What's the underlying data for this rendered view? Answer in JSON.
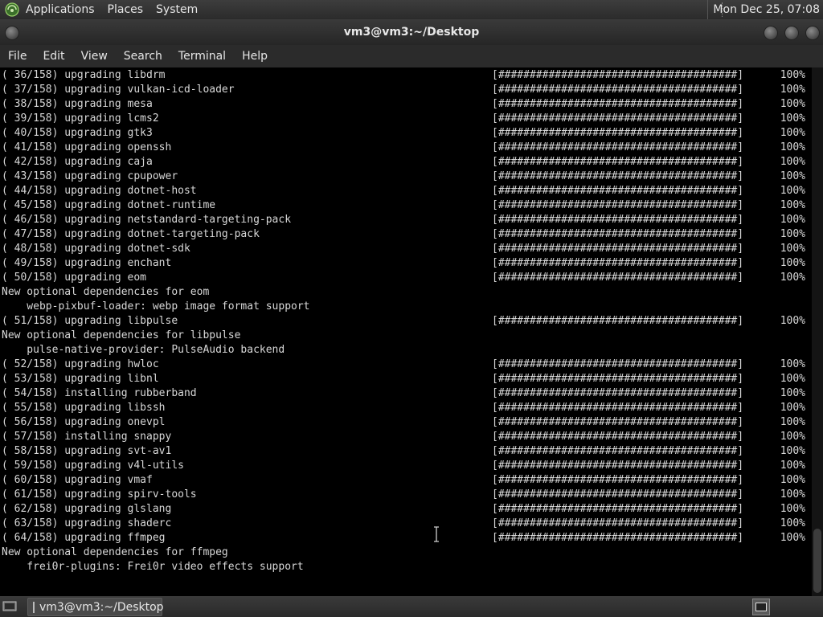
{
  "top_panel": {
    "menus": [
      "Applications",
      "Places",
      "System"
    ],
    "clock": "Mon Dec 25, 07:08"
  },
  "window": {
    "title": "vm3@vm3:~/Desktop"
  },
  "menubar": [
    "File",
    "Edit",
    "View",
    "Search",
    "Terminal",
    "Help"
  ],
  "terminal": {
    "lines": [
      {
        "text": "( 36/158) upgrading libdrm",
        "bar": "[######################################]",
        "pct": "100%"
      },
      {
        "text": "( 37/158) upgrading vulkan-icd-loader",
        "bar": "[######################################]",
        "pct": "100%"
      },
      {
        "text": "( 38/158) upgrading mesa",
        "bar": "[######################################]",
        "pct": "100%"
      },
      {
        "text": "( 39/158) upgrading lcms2",
        "bar": "[######################################]",
        "pct": "100%"
      },
      {
        "text": "( 40/158) upgrading gtk3",
        "bar": "[######################################]",
        "pct": "100%"
      },
      {
        "text": "( 41/158) upgrading openssh",
        "bar": "[######################################]",
        "pct": "100%"
      },
      {
        "text": "( 42/158) upgrading caja",
        "bar": "[######################################]",
        "pct": "100%"
      },
      {
        "text": "( 43/158) upgrading cpupower",
        "bar": "[######################################]",
        "pct": "100%"
      },
      {
        "text": "( 44/158) upgrading dotnet-host",
        "bar": "[######################################]",
        "pct": "100%"
      },
      {
        "text": "( 45/158) upgrading dotnet-runtime",
        "bar": "[######################################]",
        "pct": "100%"
      },
      {
        "text": "( 46/158) upgrading netstandard-targeting-pack",
        "bar": "[######################################]",
        "pct": "100%"
      },
      {
        "text": "( 47/158) upgrading dotnet-targeting-pack",
        "bar": "[######################################]",
        "pct": "100%"
      },
      {
        "text": "( 48/158) upgrading dotnet-sdk",
        "bar": "[######################################]",
        "pct": "100%"
      },
      {
        "text": "( 49/158) upgrading enchant",
        "bar": "[######################################]",
        "pct": "100%"
      },
      {
        "text": "( 50/158) upgrading eom",
        "bar": "[######################################]",
        "pct": "100%"
      },
      {
        "text": "New optional dependencies for eom",
        "bar": "",
        "pct": ""
      },
      {
        "text": "    webp-pixbuf-loader: webp image format support",
        "bar": "",
        "pct": ""
      },
      {
        "text": "( 51/158) upgrading libpulse",
        "bar": "[######################################]",
        "pct": "100%"
      },
      {
        "text": "New optional dependencies for libpulse",
        "bar": "",
        "pct": ""
      },
      {
        "text": "    pulse-native-provider: PulseAudio backend",
        "bar": "",
        "pct": ""
      },
      {
        "text": "( 52/158) upgrading hwloc",
        "bar": "[######################################]",
        "pct": "100%"
      },
      {
        "text": "( 53/158) upgrading libnl",
        "bar": "[######################################]",
        "pct": "100%"
      },
      {
        "text": "( 54/158) installing rubberband",
        "bar": "[######################################]",
        "pct": "100%"
      },
      {
        "text": "( 55/158) upgrading libssh",
        "bar": "[######################################]",
        "pct": "100%"
      },
      {
        "text": "( 56/158) upgrading onevpl",
        "bar": "[######################################]",
        "pct": "100%"
      },
      {
        "text": "( 57/158) installing snappy",
        "bar": "[######################################]",
        "pct": "100%"
      },
      {
        "text": "( 58/158) upgrading svt-av1",
        "bar": "[######################################]",
        "pct": "100%"
      },
      {
        "text": "( 59/158) upgrading v4l-utils",
        "bar": "[######################################]",
        "pct": "100%"
      },
      {
        "text": "( 60/158) upgrading vmaf",
        "bar": "[######################################]",
        "pct": "100%"
      },
      {
        "text": "( 61/158) upgrading spirv-tools",
        "bar": "[######################################]",
        "pct": "100%"
      },
      {
        "text": "( 62/158) upgrading glslang",
        "bar": "[######################################]",
        "pct": "100%"
      },
      {
        "text": "( 63/158) upgrading shaderc",
        "bar": "[######################################]",
        "pct": "100%"
      },
      {
        "text": "( 64/158) upgrading ffmpeg",
        "bar": "[######################################]",
        "pct": "100%"
      },
      {
        "text": "New optional dependencies for ffmpeg",
        "bar": "",
        "pct": ""
      },
      {
        "text": "    frei0r-plugins: Frei0r video effects support",
        "bar": "",
        "pct": ""
      }
    ]
  },
  "taskbar": {
    "task_label": "vm3@vm3:~/Desktop"
  },
  "colors": {
    "terminal_bg": "#000000",
    "terminal_fg": "#d8d8d8",
    "panel_bg": "#2b2b2b"
  }
}
